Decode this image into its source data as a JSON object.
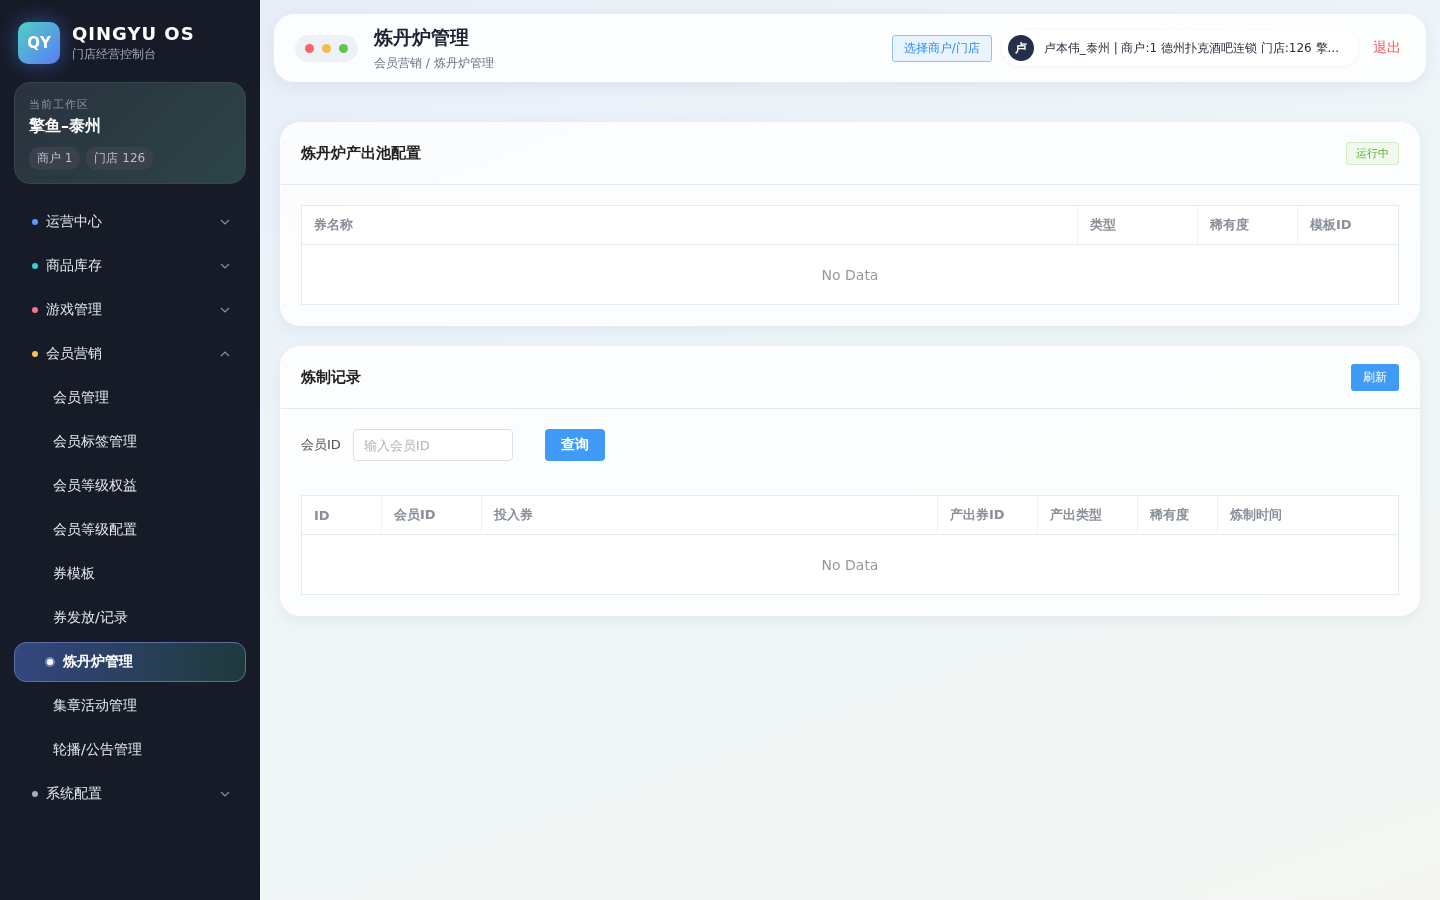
{
  "brand": {
    "logo": "QY",
    "name": "QINGYU OS",
    "subtitle": "门店经营控制台"
  },
  "workspace": {
    "label": "当前工作区",
    "name": "擎鱼–泰州",
    "tags": [
      "商户 1",
      "门店 126"
    ]
  },
  "nav": [
    {
      "label": "运营中心",
      "color": "#5b9cf8",
      "expanded": false
    },
    {
      "label": "商品库存",
      "color": "#3ccfd6",
      "expanded": false
    },
    {
      "label": "游戏管理",
      "color": "#f07894",
      "expanded": false
    },
    {
      "label": "会员营销",
      "color": "#f5c04f",
      "expanded": true,
      "children": [
        {
          "label": "会员管理",
          "selected": false
        },
        {
          "label": "会员标签管理",
          "selected": false
        },
        {
          "label": "会员等级权益",
          "selected": false
        },
        {
          "label": "会员等级配置",
          "selected": false
        },
        {
          "label": "券模板",
          "selected": false
        },
        {
          "label": "券发放/记录",
          "selected": false
        },
        {
          "label": "炼丹炉管理",
          "selected": true
        },
        {
          "label": "集章活动管理",
          "selected": false
        },
        {
          "label": "轮播/公告管理",
          "selected": false
        }
      ]
    },
    {
      "label": "系统配置",
      "color": "#a5adbd",
      "expanded": false
    }
  ],
  "header": {
    "title": "炼丹炉管理",
    "breadcrumb": "会员营销 / 炼丹炉管理",
    "select_button": "选择商户/门店",
    "avatar": "卢",
    "user": "卢本伟_泰州 | 商户:1 德州扑克酒吧连锁 门店:126 擎...",
    "logout": "退出"
  },
  "pool": {
    "title": "炼丹炉产出池配置",
    "status": "运行中",
    "columns": [
      "券名称",
      "类型",
      "稀有度",
      "模板ID"
    ],
    "empty": "No Data"
  },
  "records": {
    "title": "炼制记录",
    "refresh": "刷新",
    "filter_label": "会员ID",
    "filter_placeholder": "输入会员ID",
    "query": "查询",
    "columns": [
      "ID",
      "会员ID",
      "投入券",
      "产出券ID",
      "产出类型",
      "稀有度",
      "炼制时间"
    ],
    "empty": "No Data"
  }
}
